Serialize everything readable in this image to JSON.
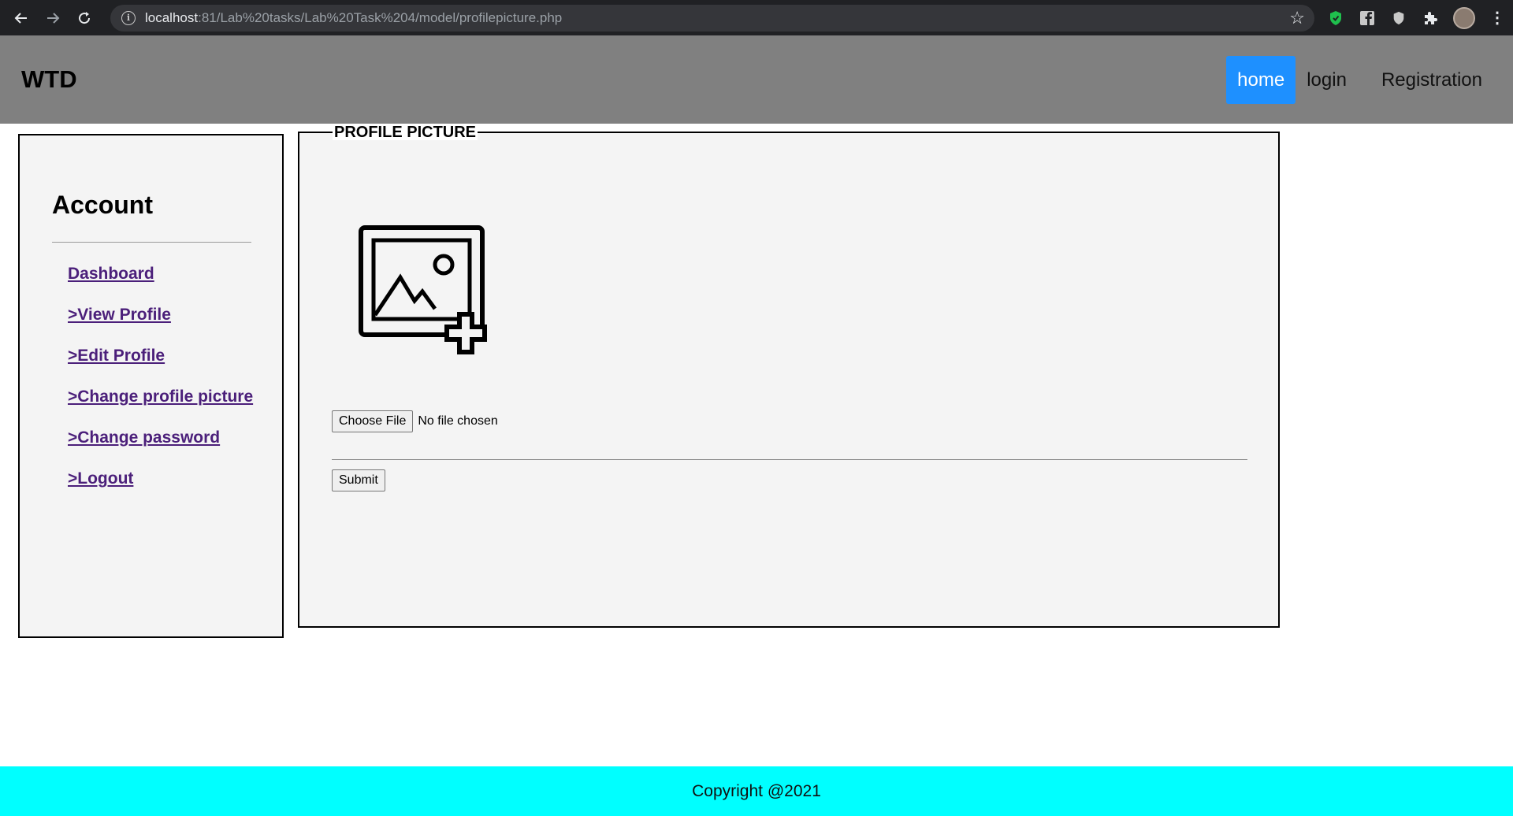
{
  "browser": {
    "url_host": "localhost",
    "url_rest": ":81/Lab%20tasks/Lab%20Task%204/model/profilepicture.php",
    "info_glyph": "i",
    "star_glyph": "☆",
    "menu_glyph": "⋮"
  },
  "header": {
    "brand": "WTD",
    "nav": [
      {
        "label": "home",
        "active": true
      },
      {
        "label": "login",
        "active": false
      },
      {
        "label": "Registration",
        "active": false
      }
    ]
  },
  "sidebar": {
    "title": "Account",
    "links": [
      {
        "label": "Dashboard"
      },
      {
        "label": ">View Profile"
      },
      {
        "label": ">Edit Profile"
      },
      {
        "label": ">Change profile picture"
      },
      {
        "label": ">Change password"
      },
      {
        "label": ">Logout"
      }
    ]
  },
  "main": {
    "legend": "PROFILE PICTURE",
    "file_button": "Choose File",
    "file_status": "No file chosen",
    "submit": "Submit",
    "icon": "add-image-icon"
  },
  "footer": {
    "text": "Copyright @2021"
  },
  "colors": {
    "header_bg": "#808080",
    "nav_active_bg": "#1e90ff",
    "panel_bg": "#f4f4f4",
    "link": "#4b1f7a",
    "footer_bg": "#00ffff",
    "browser_bg": "#202124"
  }
}
